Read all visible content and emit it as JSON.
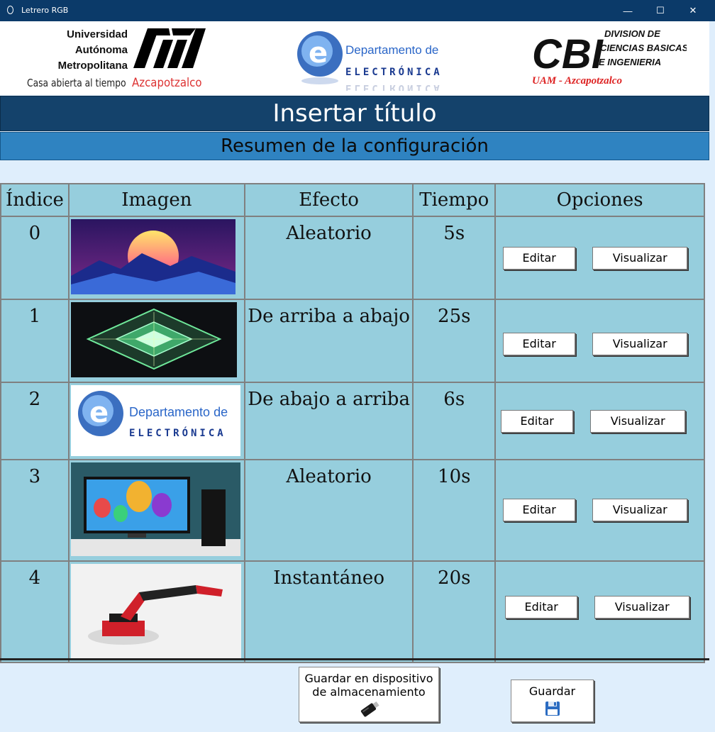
{
  "window": {
    "title": "Letrero RGB",
    "minimize": "—",
    "maximize": "☐",
    "close": "✕"
  },
  "header": {
    "uam_line1": "Universidad",
    "uam_line2": "Autónoma",
    "uam_line3": "Metropolitana",
    "uam_tagline": "Casa abierta al tiempo",
    "uam_campus": "Azcapotzalco",
    "dept_line1": "Departamento de",
    "dept_line2": "ELECTRÓNICA",
    "cbi_short": "CBI",
    "cbi_line1": "DIVISION DE",
    "cbi_line2": "CIENCIAS BASICAS",
    "cbi_line3": "E INGENIERIA",
    "cbi_campus": "UAM - Azcapotzalco"
  },
  "title": "Insertar título",
  "subtitle": "Resumen de la configuración",
  "table": {
    "headers": {
      "index": "Índice",
      "image": "Imagen",
      "effect": "Efecto",
      "time": "Tiempo",
      "options": "Opciones"
    },
    "rows": [
      {
        "index": "0",
        "image": "synthwave-sunset",
        "effect": "Aleatorio",
        "time": "5s",
        "edit": "Editar",
        "view": "Visualizar"
      },
      {
        "index": "1",
        "image": "led-matrix",
        "effect": "De arriba a abajo",
        "time": "25s",
        "edit": "Editar",
        "view": "Visualizar"
      },
      {
        "index": "2",
        "image": "electronica-logo",
        "effect": "De abajo a arriba",
        "time": "6s",
        "edit": "Editar",
        "view": "Visualizar"
      },
      {
        "index": "3",
        "image": "balloons-monitor",
        "effect": "Aleatorio",
        "time": "10s",
        "edit": "Editar",
        "view": "Visualizar"
      },
      {
        "index": "4",
        "image": "robot-arm",
        "effect": "Instantáneo",
        "time": "20s",
        "edit": "Editar",
        "view": "Visualizar"
      }
    ]
  },
  "footer": {
    "save_device_line1": "Guardar en dispositivo",
    "save_device_line2": "de almacenamiento",
    "save_label": "Guardar",
    "usb_icon": "usb-drive-icon",
    "save_icon": "floppy-disk-icon"
  },
  "colors": {
    "titlebar": "#0b3a69",
    "title_bg": "#14426b",
    "subtitle_bg": "#2f83c1",
    "table_bg": "#96cedd",
    "body_bg": "#dfeefc"
  }
}
